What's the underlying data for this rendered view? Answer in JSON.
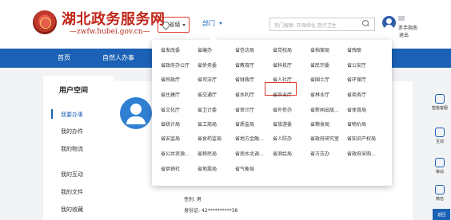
{
  "header": {
    "site_title": "湖北政务服务网",
    "site_url": "—zwfw.hubei.gov.cn—",
    "location_label": "省级",
    "dept_label": "部门",
    "search_placeholder": "热门搜索: 环保绿化 医疗卫生",
    "user_sub": "赤手指南",
    "logout_label": "退出"
  },
  "nav": {
    "items": [
      "首页",
      "自然人办事"
    ]
  },
  "sidebar": {
    "title": "用户空间",
    "items": [
      "我要办事",
      "我的办件",
      "我的物流",
      "我的互动",
      "我的文件",
      "我的收藏"
    ]
  },
  "profile": {
    "gender": "性别: 男",
    "id_number": "身份证: 42**********38"
  },
  "right_tools": [
    "智能客服",
    "互动",
    "移动",
    "微信"
  ],
  "right_top_label": "返回",
  "dropdown": {
    "selected": "省人社厅",
    "rows": [
      [
        "省发改委",
        "省编办",
        "省信访局",
        "省党校局",
        "省档案局",
        "省残联"
      ],
      [
        "省政府办公厅",
        "省侨务委",
        "省教育厅",
        "省科技厅",
        "省民宗委",
        "省公安厅"
      ],
      [
        "省民政厅",
        "省司法厅",
        "省财政厅",
        "省人社厅",
        "省国土厅",
        "省环保厅"
      ],
      [
        "省住建厅",
        "省交通厅",
        "省水利厅",
        "省农业厅",
        "省林业厅",
        "省商务厅"
      ],
      [
        "省文化厅",
        "省卫计委",
        "省审计厅",
        "省外侨办",
        "省新闻出版...",
        "省体育局"
      ],
      [
        "省统计局",
        "省工商局",
        "省质监局",
        "省旅游委",
        "省粮食局",
        "省物价局"
      ],
      [
        "省安监局",
        "省食药监局",
        "省地方金融...",
        "省人防办",
        "省政府研究室",
        "省知识产权局"
      ],
      [
        "省公共资源...",
        "省移民局",
        "省南水北调...",
        "省测绘局",
        "省方志办",
        "省政府采购..."
      ],
      [
        "省供销社",
        "省地震局",
        "省气象局"
      ]
    ]
  }
}
